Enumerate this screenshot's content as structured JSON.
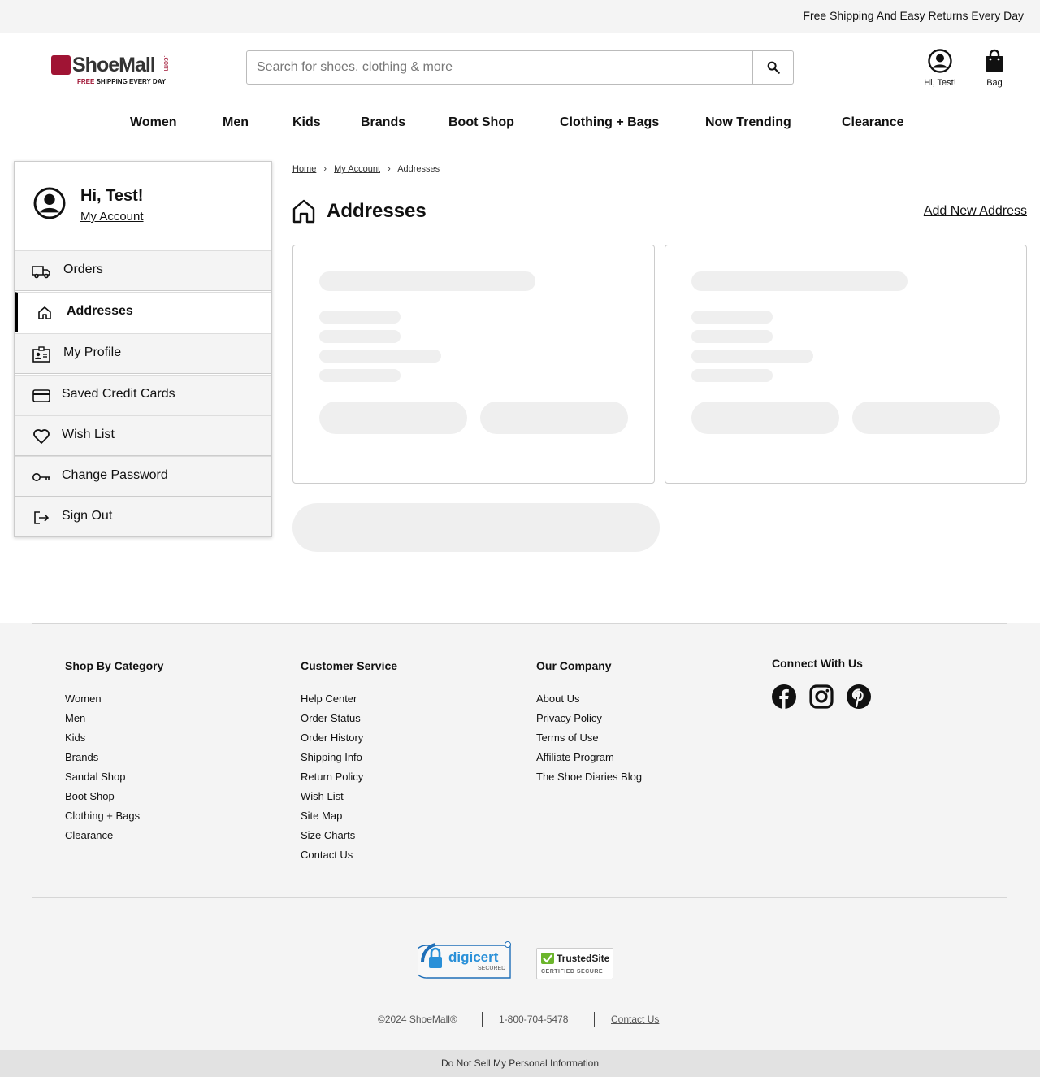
{
  "promo": {
    "text": "Free Shipping And Easy Returns Every Day"
  },
  "brand": {
    "name": "ShoeMall",
    "dotcom": ".com",
    "tagline_free": "FREE",
    "tagline_rest": " SHIPPING EVERY DAY",
    "color": "#a01434"
  },
  "search": {
    "placeholder": "Search for shoes, clothing & more",
    "value": ""
  },
  "header": {
    "user_label": "Hi, Test!",
    "bag_label": "Bag"
  },
  "nav": [
    "Women",
    "Men",
    "Kids",
    "Brands",
    "Boot Shop",
    "Clothing + Bags",
    "Now Trending",
    "Clearance"
  ],
  "sidebar": {
    "greeting": "Hi, Test!",
    "account_link": "My Account",
    "items": [
      {
        "label": "Orders",
        "icon": "truck-icon"
      },
      {
        "label": "Addresses",
        "icon": "home-icon",
        "active": true
      },
      {
        "label": "My Profile",
        "icon": "id-card-icon"
      },
      {
        "label": "Saved Credit Cards",
        "icon": "credit-card-icon"
      },
      {
        "label": "Wish List",
        "icon": "heart-icon"
      },
      {
        "label": "Change Password",
        "icon": "key-icon"
      },
      {
        "label": "Sign Out",
        "icon": "sign-out-icon"
      }
    ]
  },
  "breadcrumb": {
    "home": "Home",
    "account": "My Account",
    "current": "Addresses"
  },
  "page": {
    "title": "Addresses",
    "add_link": "Add New Address"
  },
  "footer": {
    "col1": {
      "title": "Shop By Category",
      "links": [
        "Women",
        "Men",
        "Kids",
        "Brands",
        "Sandal Shop",
        "Boot Shop",
        "Clothing + Bags",
        "Clearance"
      ]
    },
    "col2": {
      "title": "Customer Service",
      "links": [
        "Help Center",
        "Order Status",
        "Order History",
        "Shipping Info",
        "Return Policy",
        "Wish List",
        "Site Map",
        "Size Charts",
        "Contact Us"
      ]
    },
    "col3": {
      "title": "Our Company",
      "links": [
        "About Us",
        "Privacy Policy",
        "Terms of Use",
        "Affiliate Program",
        "The Shoe Diaries Blog"
      ]
    },
    "col4": {
      "title": "Connect With Us",
      "social": [
        "facebook-icon",
        "instagram-icon",
        "pinterest-icon"
      ]
    },
    "digicert": {
      "name": "digicert",
      "sub": "SECURED"
    },
    "trustedsite": {
      "name": "TrustedSite",
      "sub": "CERTIFIED SECURE"
    },
    "copyright": "©2024 ShoeMall®",
    "phone": "1-800-704-5478",
    "contact": "Contact Us",
    "do_not_sell": "Do Not Sell My Personal Information"
  }
}
